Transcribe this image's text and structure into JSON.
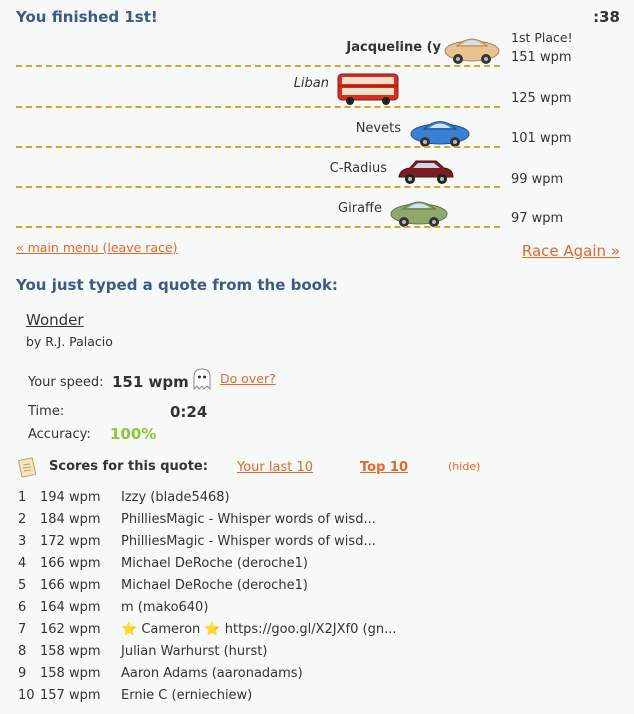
{
  "header": {
    "finished": "You finished 1st!",
    "timer": ":38"
  },
  "race": {
    "racers": [
      {
        "name": "Jacqueline (y",
        "place": "1st Place!",
        "wpm": "151 wpm",
        "vehicle": "tan-beetle-car",
        "color": "#e7c38f",
        "you": true
      },
      {
        "name": "Liban",
        "place": "",
        "wpm": "125 wpm",
        "vehicle": "red-double-decker-bus",
        "color": "#d62d24",
        "you": false
      },
      {
        "name": "Nevets",
        "place": "",
        "wpm": "101 wpm",
        "vehicle": "blue-beetle-car",
        "color": "#3a7fd6",
        "you": false
      },
      {
        "name": "C-Radius",
        "place": "",
        "wpm": "99 wpm",
        "vehicle": "maroon-car",
        "color": "#7a1c22",
        "you": false
      },
      {
        "name": "Giraffe",
        "place": "",
        "wpm": "97 wpm",
        "vehicle": "green-beetle-car",
        "color": "#8fa86b",
        "you": false
      }
    ],
    "lane_color": "#d5a52a"
  },
  "links": {
    "main_menu": "« main menu (leave race)",
    "race_again": "Race Again »"
  },
  "quote": {
    "heading": "You just typed a quote from the book:",
    "title": "Wonder",
    "author": "by R.J. Palacio"
  },
  "stats": {
    "speed_label": "Your speed:",
    "speed_value": "151 wpm",
    "do_over": "Do over?",
    "time_label": "Time:",
    "time_value": "0:24",
    "accuracy_label": "Accuracy:",
    "accuracy_value": "100%",
    "accuracy_color": "#8bc63f"
  },
  "scores": {
    "label": "Scores for this quote:",
    "tab_last": "Your last 10",
    "tab_top": "Top 10",
    "hide": "(hide)",
    "rows": [
      {
        "rank": "1",
        "wpm": "194 wpm",
        "user": "Izzy (blade5468)"
      },
      {
        "rank": "2",
        "wpm": "184 wpm",
        "user": "PhilliesMagic - Whisper words of wisd..."
      },
      {
        "rank": "3",
        "wpm": "172 wpm",
        "user": "PhilliesMagic - Whisper words of wisd..."
      },
      {
        "rank": "4",
        "wpm": "166 wpm",
        "user": "Michael DeRoche (deroche1)"
      },
      {
        "rank": "5",
        "wpm": "166 wpm",
        "user": "Michael DeRoche (deroche1)"
      },
      {
        "rank": "6",
        "wpm": "164 wpm",
        "user": "m (mako640)"
      },
      {
        "rank": "7",
        "wpm": "162 wpm",
        "user": "⭐ Cameron ⭐ https://goo.gl/X2JXf0 (gn..."
      },
      {
        "rank": "8",
        "wpm": "158 wpm",
        "user": "Julian Warhurst (hurst)"
      },
      {
        "rank": "9",
        "wpm": "158 wpm",
        "user": "Aaron Adams (aaronadams)"
      },
      {
        "rank": "10",
        "wpm": "157 wpm",
        "user": "Ernie C (erniechiew)"
      }
    ]
  },
  "colors": {
    "heading": "#3c5a86",
    "link": "#e2692a",
    "background": "#f7f8f8"
  }
}
